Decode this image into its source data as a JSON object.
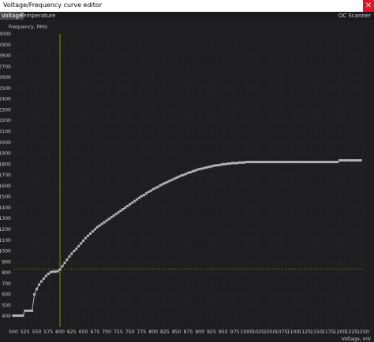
{
  "window": {
    "title": "Voltage/Frequency curve editor",
    "close_glyph": "✕"
  },
  "tabs": [
    {
      "label": "Voltage",
      "active": true
    },
    {
      "label": "Temperature",
      "active": false
    }
  ],
  "oc_scanner_label": "OC Scanner",
  "colors": {
    "background": "#1e1e20",
    "grid": "#3a3a3c",
    "curve": "#b4b4b4",
    "cursor_line": "#8a8a22"
  },
  "chart_data": {
    "type": "line",
    "ylabel": "Frequency, MHz",
    "xlabel": "Voltage, mV",
    "xlim": [
      500,
      1250
    ],
    "ylim": [
      300,
      3000
    ],
    "x_ticks": [
      "500",
      "525",
      "550",
      "575",
      "600",
      "625",
      "650",
      "675",
      "700",
      "725",
      "750",
      "775",
      "800",
      "825",
      "850",
      "875",
      "900",
      "925",
      "950",
      "975",
      "1000",
      "1025",
      "1050",
      "1075",
      "1100",
      "1125",
      "1150",
      "1175",
      "1200",
      "1225",
      "1250"
    ],
    "y_ticks": [
      "400",
      "500",
      "600",
      "700",
      "800",
      "900",
      "1000",
      "1100",
      "1200",
      "1300",
      "1400",
      "1500",
      "1600",
      "1700",
      "1800",
      "1900",
      "2000",
      "2100",
      "2200",
      "2300",
      "2400",
      "2500",
      "2600",
      "2700",
      "2800",
      "2900",
      "3000"
    ],
    "grid": true,
    "current_voltage_marker": 600,
    "current_frequency_marker": 835,
    "series": [
      {
        "points": [
          [
            500,
            405
          ],
          [
            505,
            405
          ],
          [
            510,
            405
          ],
          [
            515,
            405
          ],
          [
            520,
            405
          ],
          [
            525,
            450
          ],
          [
            530,
            450
          ],
          [
            535,
            450
          ],
          [
            540,
            450
          ],
          [
            545,
            600
          ],
          [
            550,
            650
          ],
          [
            555,
            690
          ],
          [
            560,
            720
          ],
          [
            565,
            745
          ],
          [
            570,
            770
          ],
          [
            575,
            790
          ],
          [
            580,
            805
          ],
          [
            585,
            810
          ],
          [
            590,
            810
          ],
          [
            595,
            815
          ],
          [
            600,
            830
          ],
          [
            605,
            860
          ],
          [
            610,
            890
          ],
          [
            615,
            920
          ],
          [
            620,
            950
          ],
          [
            625,
            975
          ],
          [
            630,
            1000
          ],
          [
            635,
            1020
          ],
          [
            640,
            1045
          ],
          [
            645,
            1070
          ],
          [
            650,
            1095
          ],
          [
            655,
            1120
          ],
          [
            660,
            1140
          ],
          [
            665,
            1160
          ],
          [
            670,
            1180
          ],
          [
            675,
            1200
          ],
          [
            680,
            1220
          ],
          [
            685,
            1235
          ],
          [
            690,
            1250
          ],
          [
            695,
            1265
          ],
          [
            700,
            1280
          ],
          [
            705,
            1295
          ],
          [
            710,
            1310
          ],
          [
            715,
            1325
          ],
          [
            720,
            1340
          ],
          [
            725,
            1355
          ],
          [
            730,
            1370
          ],
          [
            735,
            1385
          ],
          [
            740,
            1400
          ],
          [
            745,
            1415
          ],
          [
            750,
            1430
          ],
          [
            755,
            1445
          ],
          [
            760,
            1460
          ],
          [
            765,
            1475
          ],
          [
            770,
            1490
          ],
          [
            775,
            1505
          ],
          [
            780,
            1515
          ],
          [
            785,
            1530
          ],
          [
            790,
            1545
          ],
          [
            795,
            1555
          ],
          [
            800,
            1570
          ],
          [
            805,
            1580
          ],
          [
            810,
            1590
          ],
          [
            815,
            1605
          ],
          [
            820,
            1615
          ],
          [
            825,
            1625
          ],
          [
            830,
            1635
          ],
          [
            835,
            1645
          ],
          [
            840,
            1655
          ],
          [
            845,
            1665
          ],
          [
            850,
            1675
          ],
          [
            855,
            1685
          ],
          [
            860,
            1695
          ],
          [
            865,
            1700
          ],
          [
            870,
            1710
          ],
          [
            875,
            1720
          ],
          [
            880,
            1725
          ],
          [
            885,
            1735
          ],
          [
            890,
            1740
          ],
          [
            895,
            1750
          ],
          [
            900,
            1755
          ],
          [
            905,
            1760
          ],
          [
            910,
            1765
          ],
          [
            915,
            1770
          ],
          [
            920,
            1775
          ],
          [
            925,
            1780
          ],
          [
            930,
            1785
          ],
          [
            935,
            1790
          ],
          [
            940,
            1790
          ],
          [
            945,
            1795
          ],
          [
            950,
            1800
          ],
          [
            955,
            1800
          ],
          [
            960,
            1805
          ],
          [
            965,
            1805
          ],
          [
            970,
            1810
          ],
          [
            975,
            1810
          ],
          [
            980,
            1810
          ],
          [
            985,
            1815
          ],
          [
            990,
            1815
          ],
          [
            995,
            1815
          ],
          [
            1000,
            1820
          ],
          [
            1005,
            1820
          ],
          [
            1010,
            1820
          ],
          [
            1015,
            1820
          ],
          [
            1020,
            1820
          ],
          [
            1025,
            1820
          ],
          [
            1030,
            1820
          ],
          [
            1035,
            1820
          ],
          [
            1040,
            1820
          ],
          [
            1045,
            1820
          ],
          [
            1050,
            1820
          ],
          [
            1055,
            1820
          ],
          [
            1060,
            1820
          ],
          [
            1065,
            1820
          ],
          [
            1070,
            1820
          ],
          [
            1075,
            1820
          ],
          [
            1080,
            1820
          ],
          [
            1085,
            1820
          ],
          [
            1090,
            1820
          ],
          [
            1095,
            1820
          ],
          [
            1100,
            1820
          ],
          [
            1105,
            1820
          ],
          [
            1110,
            1820
          ],
          [
            1115,
            1820
          ],
          [
            1120,
            1820
          ],
          [
            1125,
            1820
          ],
          [
            1130,
            1820
          ],
          [
            1135,
            1820
          ],
          [
            1140,
            1820
          ],
          [
            1145,
            1820
          ],
          [
            1150,
            1820
          ],
          [
            1155,
            1820
          ],
          [
            1160,
            1820
          ],
          [
            1165,
            1820
          ],
          [
            1170,
            1820
          ],
          [
            1175,
            1820
          ],
          [
            1180,
            1820
          ],
          [
            1185,
            1820
          ],
          [
            1190,
            1820
          ],
          [
            1195,
            1820
          ],
          [
            1200,
            1835
          ],
          [
            1205,
            1835
          ],
          [
            1210,
            1835
          ],
          [
            1215,
            1835
          ],
          [
            1220,
            1835
          ],
          [
            1225,
            1835
          ],
          [
            1230,
            1835
          ],
          [
            1235,
            1835
          ],
          [
            1240,
            1835
          ],
          [
            1245,
            1835
          ]
        ]
      }
    ]
  }
}
